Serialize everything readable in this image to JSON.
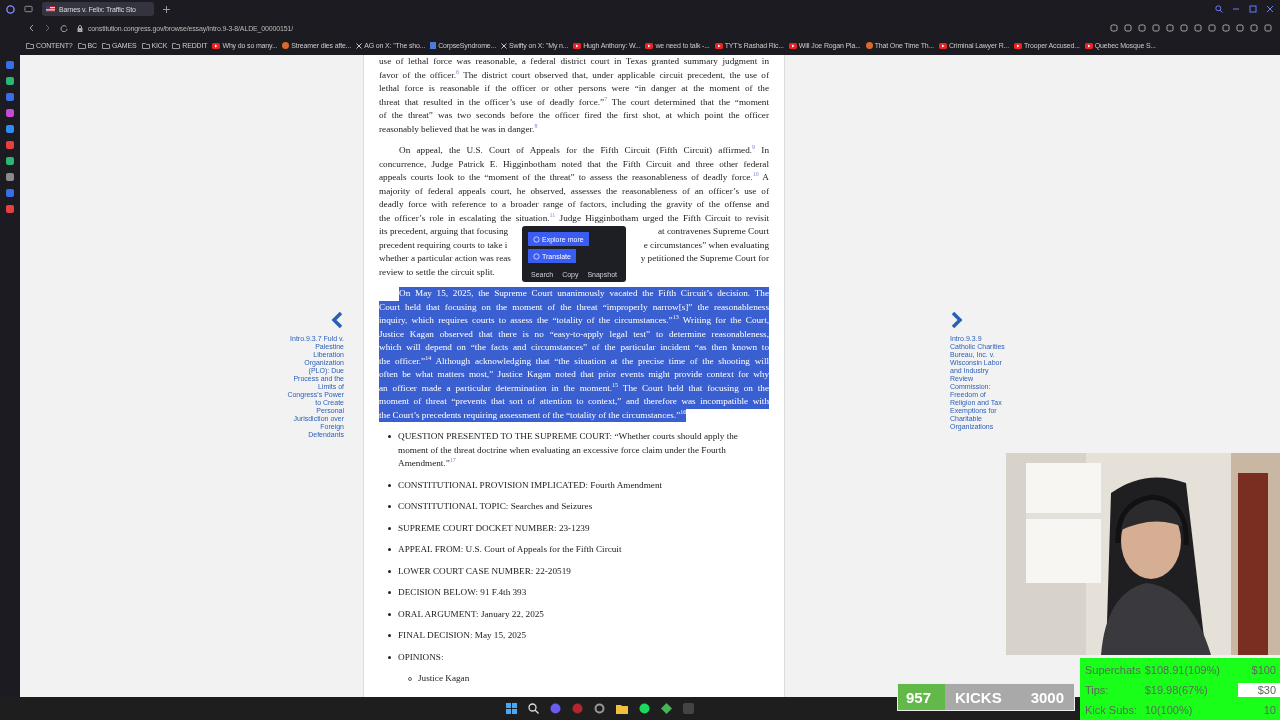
{
  "browser": {
    "tab": {
      "title": "Barnes v. Felix: Traffic Sto",
      "selected": true
    },
    "url": "constitution.congress.gov/browse/essay/intro.9-3-8/ALDE_00000151/",
    "bookmarks": [
      {
        "label": "CONTENT?",
        "kind": "folder"
      },
      {
        "label": "BC",
        "kind": "folder"
      },
      {
        "label": "GAMES",
        "kind": "folder"
      },
      {
        "label": "KICK",
        "kind": "folder"
      },
      {
        "label": "REDDIT",
        "kind": "folder"
      },
      {
        "label": "Why do so many...",
        "kind": "video"
      },
      {
        "label": "Streamer dies afte...",
        "kind": "avatar"
      },
      {
        "label": "AG on X: \"The sho...",
        "kind": "x"
      },
      {
        "label": "CorpseSyndrome...",
        "kind": "page"
      },
      {
        "label": "Swifty on X: \"My n...",
        "kind": "x"
      },
      {
        "label": "Hugh Anthony: W...",
        "kind": "video"
      },
      {
        "label": "we need to talk -...",
        "kind": "video"
      },
      {
        "label": "TYT's Rashad Ric...",
        "kind": "video"
      },
      {
        "label": "Will Joe Rogan Pla...",
        "kind": "video"
      },
      {
        "label": "That One Time Th...",
        "kind": "avatar"
      },
      {
        "label": "Criminal Lawyer R...",
        "kind": "video"
      },
      {
        "label": "Trooper Accused...",
        "kind": "video"
      },
      {
        "label": "Quebec Mosque S...",
        "kind": "video"
      }
    ]
  },
  "prev_link": "Intro.9.3.7 Fuld v. Palestine Liberation Organization (PLO): Due Process and the Limits of Congress's Power to Create Personal Jurisdiction over Foreign Defendants",
  "next_link": "Intro.9.3.9 Catholic Charities Bureau, Inc. v. Wisconsin Labor and Industry Review Commission: Freedom of Religion and Tax Exemptions for Charitable Organizations",
  "paragraphs": [
    {
      "continued": true,
      "highlighted": false,
      "lines": [
        [
          "use of lethal force was reasonable, a federal district court in Texas granted summary judgment in"
        ],
        [
          "favor of the officer.$^{6}$ The district court observed that, under applicable circuit precedent, the use of"
        ],
        [
          "lethal force is reasonable if the officer or other persons were “in danger at the moment of the"
        ],
        [
          "threat that resulted in the officer’s use of deadly force.”$^{7}$ The court determined that the “moment"
        ],
        [
          "of the threat” was two seconds before the officer fired the first shot, at which point the officer"
        ],
        [
          "reasonably believed that he was in danger.$^{8}$"
        ]
      ]
    },
    {
      "continued": false,
      "highlighted": false,
      "lines": [
        [
          "On appeal, the U.S. Court of Appeals for the Fifth Circuit (Fifth Circuit) affirmed.$^{9}$ In"
        ],
        [
          "concurrence, Judge Patrick E. Higginbotham noted that the Fifth Circuit and three other federal"
        ],
        [
          "appeals courts look to the “moment of the threat” to assess the reasonableness of deadly force.$^{10}$ A"
        ],
        [
          "majority of federal appeals court, he observed, assesses the reasonableness of an officer’s use of"
        ],
        [
          "deadly force with reference to a broader range of factors, including the gravity of the offense and"
        ],
        [
          "the officer’s role in escalating the situation.$^{11}$ Judge Higginbotham urged the Fifth Circuit to revisit"
        ],
        [
          "its precedent, arguing that focusing",
          "at contravenes Supreme Court"
        ],
        [
          "precedent requiring courts to take i",
          "e circumstances” when evaluating"
        ],
        [
          "whether a particular action was reas",
          "y petitioned the Supreme Court for"
        ],
        [
          "review to settle the circuit split."
        ]
      ]
    },
    {
      "continued": false,
      "highlighted": true,
      "lines": [
        [
          "On May 15, 2025, the Supreme Court unanimously vacated the Fifth Circuit’s decision. The"
        ],
        [
          "Court held that focusing on the moment of the threat “improperly narrow[s]” the reasonableness"
        ],
        [
          "inquiry, which requires courts to assess the “totality of the circumstances.”$^{13}$ Writing for the Court,"
        ],
        [
          "Justice Kagan observed that there is no “easy-to-apply legal test” to determine reasonableness,"
        ],
        [
          "which will depend on “the facts and circumstances” of the particular incident “as then known to"
        ],
        [
          "the officer.”$^{14}$ Although acknowledging that “the situation at the precise time of the shooting will"
        ],
        [
          "often be what matters most,” Justice Kagan noted that prior events might provide context for why"
        ],
        [
          "an officer made a particular determination in the moment.$^{15}$ The Court held that focusing on the"
        ],
        [
          "moment of threat “prevents that sort of attention to context,” and therefore was incompatible with"
        ],
        [
          "the Court’s precedents requiring assessment of the “totality of the circumstances.”$^{16}$"
        ]
      ]
    }
  ],
  "popup": {
    "actions": [
      "Explore more",
      "Translate"
    ],
    "tools": [
      "Search",
      "Copy",
      "Snapshot"
    ]
  },
  "facts": [
    {
      "text": "QUESTION PRESENTED TO THE SUPREME COURT: “Whether courts should apply the moment of the threat doctrine when evaluating an excessive force claim under the Fourth Amendment.”$^{17}$"
    },
    {
      "text": "CONSTITUTIONAL PROVISION IMPLICATED: Fourth Amendment"
    },
    {
      "text": "CONSTITUTIONAL TOPIC: Searches and Seizures"
    },
    {
      "text": "SUPREME COURT DOCKET NUMBER: 23-1239"
    },
    {
      "text": "APPEAL FROM: U.S. Court of Appeals for the Fifth Circuit"
    },
    {
      "text": "LOWER COURT CASE NUMBER: 22-20519"
    },
    {
      "text": "DECISION BELOW: 91 F.4th 393"
    },
    {
      "text": "ORAL ARGUMENT: January 22, 2025"
    },
    {
      "text": "FINAL DECISION: May 15, 2025"
    },
    {
      "text": "OPINIONS:",
      "children": [
        {
          "text": "Justice Kagan"
        }
      ]
    }
  ],
  "kicks": {
    "count": "957",
    "label": "KICKS",
    "goal": "3000"
  },
  "goals": [
    {
      "label": "Superchats",
      "amount": "$108.91(109%)",
      "target": "$100",
      "highlighted": false
    },
    {
      "label": "Tips:",
      "amount": "$19.98(67%)",
      "target": "$30",
      "highlighted": true
    },
    {
      "label": "Kick Subs:",
      "amount": "10(100%)",
      "target": "10",
      "highlighted": false
    }
  ]
}
